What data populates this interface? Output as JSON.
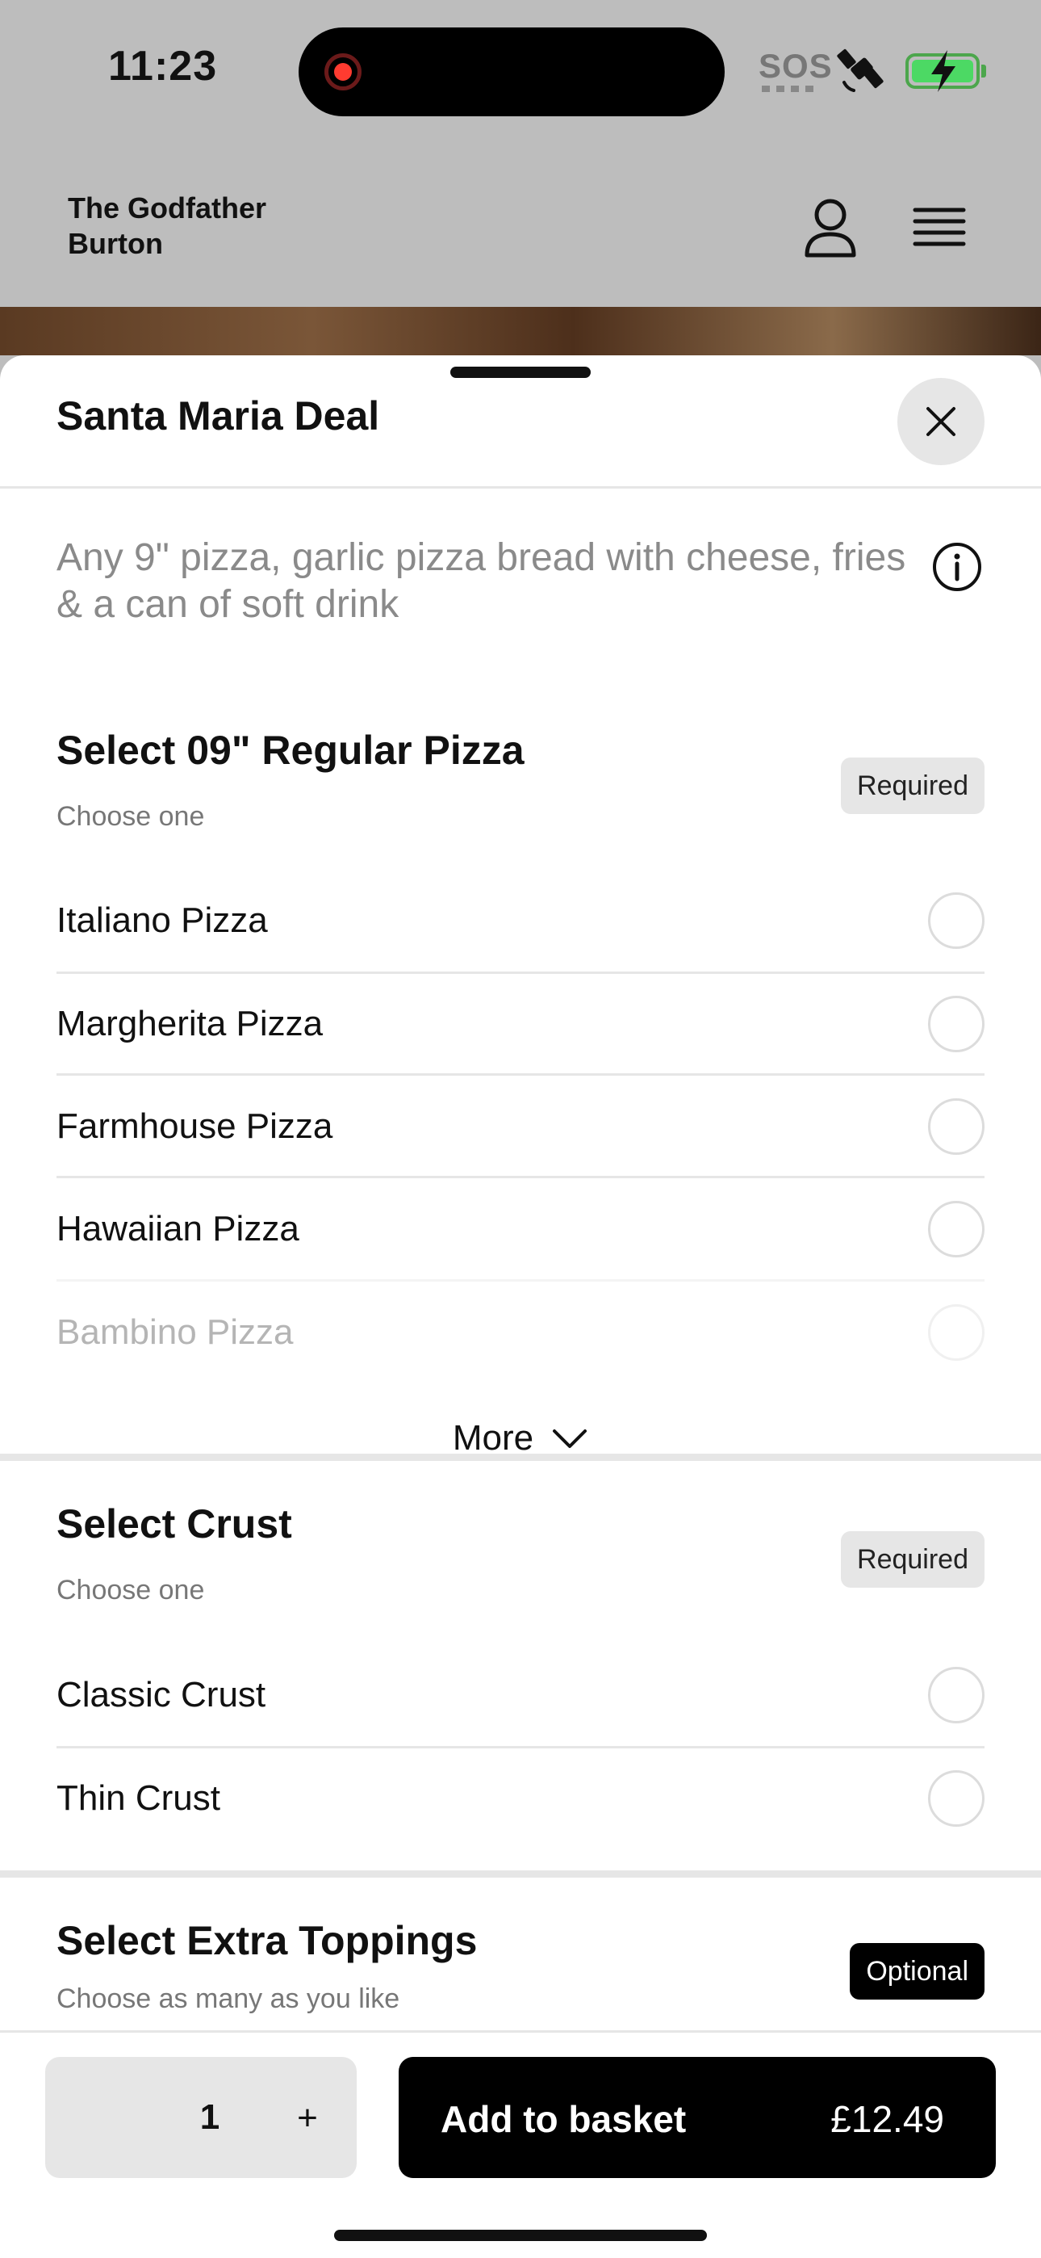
{
  "status_bar": {
    "time": "11:23",
    "sos": "SOS",
    "icons": [
      "screen-recording-icon",
      "satellite-icon",
      "battery-charging-icon"
    ],
    "battery_color": "#4cd964"
  },
  "header": {
    "restaurant_name_line1": "The Godfather",
    "restaurant_name_line2": "Burton",
    "icons": [
      "user-icon",
      "hamburger-menu-icon"
    ]
  },
  "sheet": {
    "title": "Santa Maria Deal",
    "description": "Any 9\" pizza, garlic pizza bread with cheese, fries & a can of soft drink"
  },
  "sections": [
    {
      "title": "Select 09\" Regular Pizza",
      "subtitle": "Choose one",
      "badge": "Required",
      "options": [
        "Italiano Pizza",
        "Margherita Pizza",
        "Farmhouse Pizza",
        "Hawaiian Pizza",
        "Bambino Pizza"
      ],
      "more_label": "More"
    },
    {
      "title": "Select Crust",
      "subtitle": "Choose one",
      "badge": "Required",
      "options": [
        "Classic Crust",
        "Thin Crust"
      ]
    },
    {
      "title": "Select Extra Toppings",
      "subtitle": "Choose as many as you like",
      "badge": "Optional"
    }
  ],
  "footer": {
    "quantity": "1",
    "plus": "+",
    "add_label": "Add to basket",
    "price": "£12.49"
  },
  "colors": {
    "accent": "#000000",
    "badge_required_bg": "#e6e6e6",
    "recording": "#ff3b30"
  }
}
